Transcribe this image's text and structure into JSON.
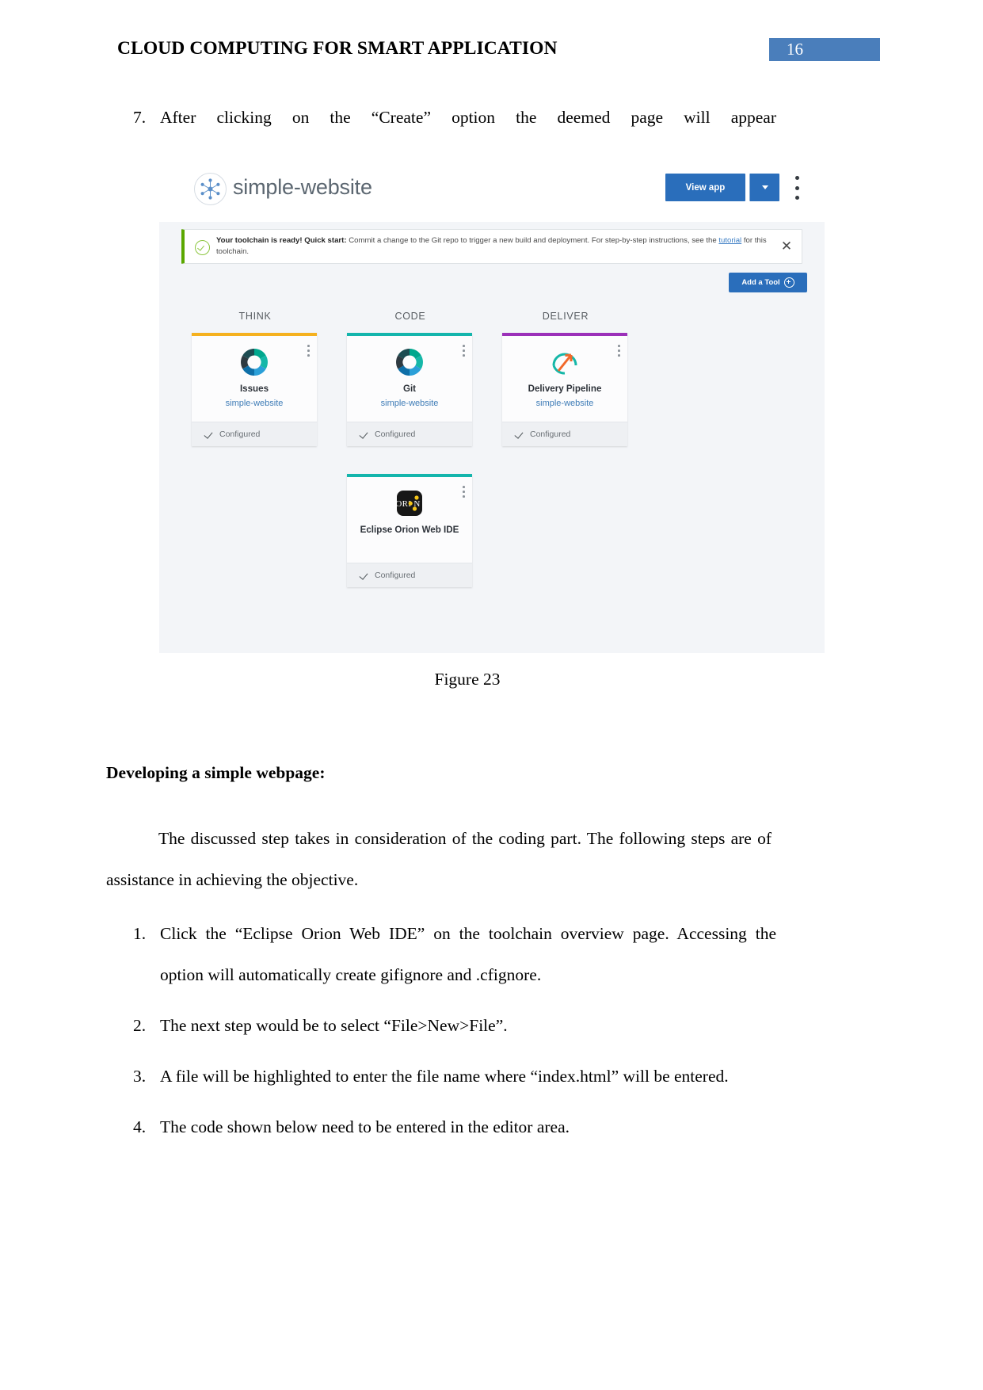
{
  "header": {
    "title": "CLOUD COMPUTING FOR SMART APPLICATION",
    "page_number": "16"
  },
  "item7": {
    "number": "7.",
    "text": "After clicking on the “Create” option the deemed page will appear"
  },
  "screenshot": {
    "topbar": {
      "logo_icon": "toolchain-hex-icon",
      "title": "simple-website",
      "view_app_label": "View app",
      "caret_icon": "chevron-down-icon",
      "overflow_icon": "kebab-menu-icon"
    },
    "banner": {
      "status_icon": "check-circle-icon",
      "bold_lead": "Your toolchain is ready! Quick start:",
      "body_before_link": " Commit a change to the Git repo to trigger a new build and deployment. For step-by-step instructions, see the ",
      "link_text": "tutorial",
      "body_after_link": " for this toolchain.",
      "close_icon": "close-icon",
      "accent_color": "#5aa700"
    },
    "add_tool": {
      "label": "Add a Tool",
      "icon": "plus-circle-icon"
    },
    "columns": [
      {
        "label": "THINK",
        "accent": "#f5b11f"
      },
      {
        "label": "CODE",
        "accent": "#14b5ac"
      },
      {
        "label": "DELIVER",
        "accent": "#9b30b9"
      }
    ],
    "cards": [
      {
        "name": "Issues",
        "subtitle": "simple-website",
        "status": "Configured",
        "accent": "#f5b11f",
        "icon": "issues-donut-icon",
        "overflow_icon": "kebab-menu-icon",
        "status_icon": "check-icon"
      },
      {
        "name": "Git",
        "subtitle": "simple-website",
        "status": "Configured",
        "accent": "#14b5ac",
        "icon": "git-donut-icon",
        "overflow_icon": "kebab-menu-icon",
        "status_icon": "check-icon"
      },
      {
        "name": "Delivery Pipeline",
        "subtitle": "simple-website",
        "status": "Configured",
        "accent": "#9b30b9",
        "icon": "delivery-pipeline-icon",
        "overflow_icon": "kebab-menu-icon",
        "status_icon": "check-icon"
      },
      {
        "name": "Eclipse Orion Web IDE",
        "subtitle": "",
        "status": "Configured",
        "accent": "#14b5ac",
        "icon": "orion-icon",
        "overflow_icon": "kebab-menu-icon",
        "status_icon": "check-icon"
      }
    ]
  },
  "figure_caption": "Figure 23",
  "section": {
    "heading": "Developing a simple webpage:",
    "paragraph": "The discussed step takes in consideration of the coding part. The following steps are of assistance in achieving the objective."
  },
  "steps": [
    {
      "number": "1.",
      "line1": "Click the “Eclipse Orion Web IDE” on the toolchain overview page. Accessing the",
      "line2": "option will automatically create gifignore and .cfignore."
    },
    {
      "number": "2.",
      "line1": "The next step would be to select “File>New>File”.",
      "line2": ""
    },
    {
      "number": "3.",
      "line1": "A file will be highlighted to enter the file name where “index.html” will be entered.",
      "line2": ""
    },
    {
      "number": "4.",
      "line1": "The code shown below need to be entered in the editor area.",
      "line2": ""
    }
  ]
}
